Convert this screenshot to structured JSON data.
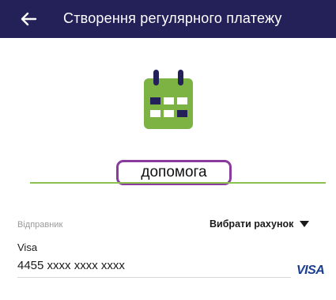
{
  "header": {
    "title": "Створення регулярного платежу",
    "back_icon": "arrow-left-icon",
    "background": "#232158"
  },
  "hero": {
    "icon": "calendar-icon",
    "icon_color": "#7cb342"
  },
  "purpose": {
    "value": "допомога",
    "highlight_color": "#8a3b9e",
    "underline_color": "#8cc152"
  },
  "sender": {
    "label": "Відправник",
    "choose_label": "Вибрати рахунок",
    "card_type": "Visa",
    "card_number": "4455 xxxx xxxx xxxx",
    "card_brand": "VISA"
  }
}
